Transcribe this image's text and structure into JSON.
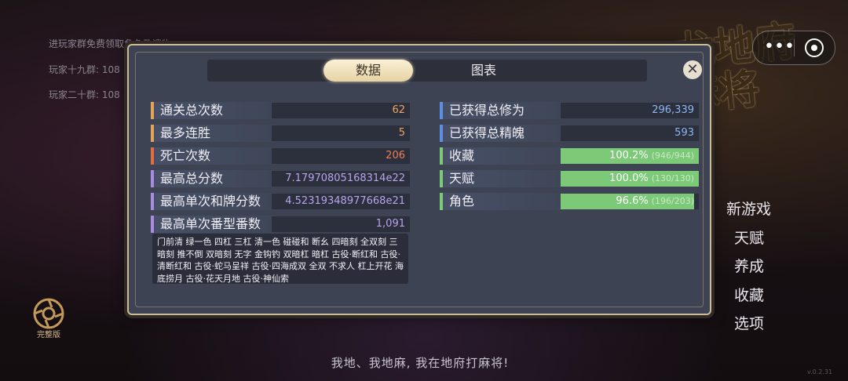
{
  "background": {
    "lines": [
      "进玩家群免费领取角色及遗物",
      "玩家十九群: 108",
      "玩家二十群: 108"
    ],
    "logo_title": "龙地府麻将",
    "subtitle": "我地、我地麻, 我在地府打麻将!",
    "badge_label": "完整版",
    "version": "v.0.2.31"
  },
  "capsule": {
    "menu_icon": "•••"
  },
  "side_menu": [
    "新游戏",
    "天赋",
    "养成",
    "收藏",
    "选项"
  ],
  "panel": {
    "tabs": [
      {
        "label": "数据",
        "active": true
      },
      {
        "label": "图表",
        "active": false
      }
    ],
    "close_label": "✕",
    "left_stats": [
      {
        "label": "通关总次数",
        "value": "62",
        "accent": "#e3a459",
        "value_color": "#e9a766"
      },
      {
        "label": "最多连胜",
        "value": "5",
        "accent": "#e3a459",
        "value_color": "#e9a766"
      },
      {
        "label": "死亡次数",
        "value": "206",
        "accent": "#e06e3f",
        "value_color": "#ec7f58"
      },
      {
        "label": "最高总分数",
        "value": "7.17970805168314e22",
        "accent": "#a98be0",
        "value_color": "#b9a4ee"
      },
      {
        "label": "最高单次和牌分数",
        "value": "4.52319348977668e21",
        "accent": "#a98be0",
        "value_color": "#b9a4ee"
      },
      {
        "label": "最高单次番型番数",
        "value": "1,091",
        "accent": "#a98be0",
        "value_color": "#b9a4ee"
      }
    ],
    "right_stats": [
      {
        "label": "已获得总修为",
        "value": "296,339",
        "accent": "#5c8fe3",
        "value_color": "#8db7f3"
      },
      {
        "label": "已获得总精魄",
        "value": "593",
        "accent": "#5c8fe3",
        "value_color": "#8db7f3"
      }
    ],
    "right_progress": [
      {
        "label": "收藏",
        "percent_text": "100.2%",
        "detail": "(946/944)",
        "fraction": 1.0,
        "accent": "#7cc978"
      },
      {
        "label": "天赋",
        "percent_text": "100.0%",
        "detail": "(130/130)",
        "fraction": 1.0,
        "accent": "#7cc978"
      },
      {
        "label": "角色",
        "percent_text": "96.6%",
        "detail": "(196/203)",
        "fraction": 0.966,
        "accent": "#7cc978"
      }
    ],
    "yaku_text": "门前清 绿一色 四杠 三杠 清一色 碰碰和 断幺 四暗刻 全双刻 三暗刻 推不倒 双暗刻 无字 金钩钓 双暗杠 暗杠 古役·断红和 古役·清断红和 古役·蛇马呈祥 古役·四海成双 全双 不求人 杠上开花 海底捞月 古役·花天月地 古役·神仙索"
  }
}
